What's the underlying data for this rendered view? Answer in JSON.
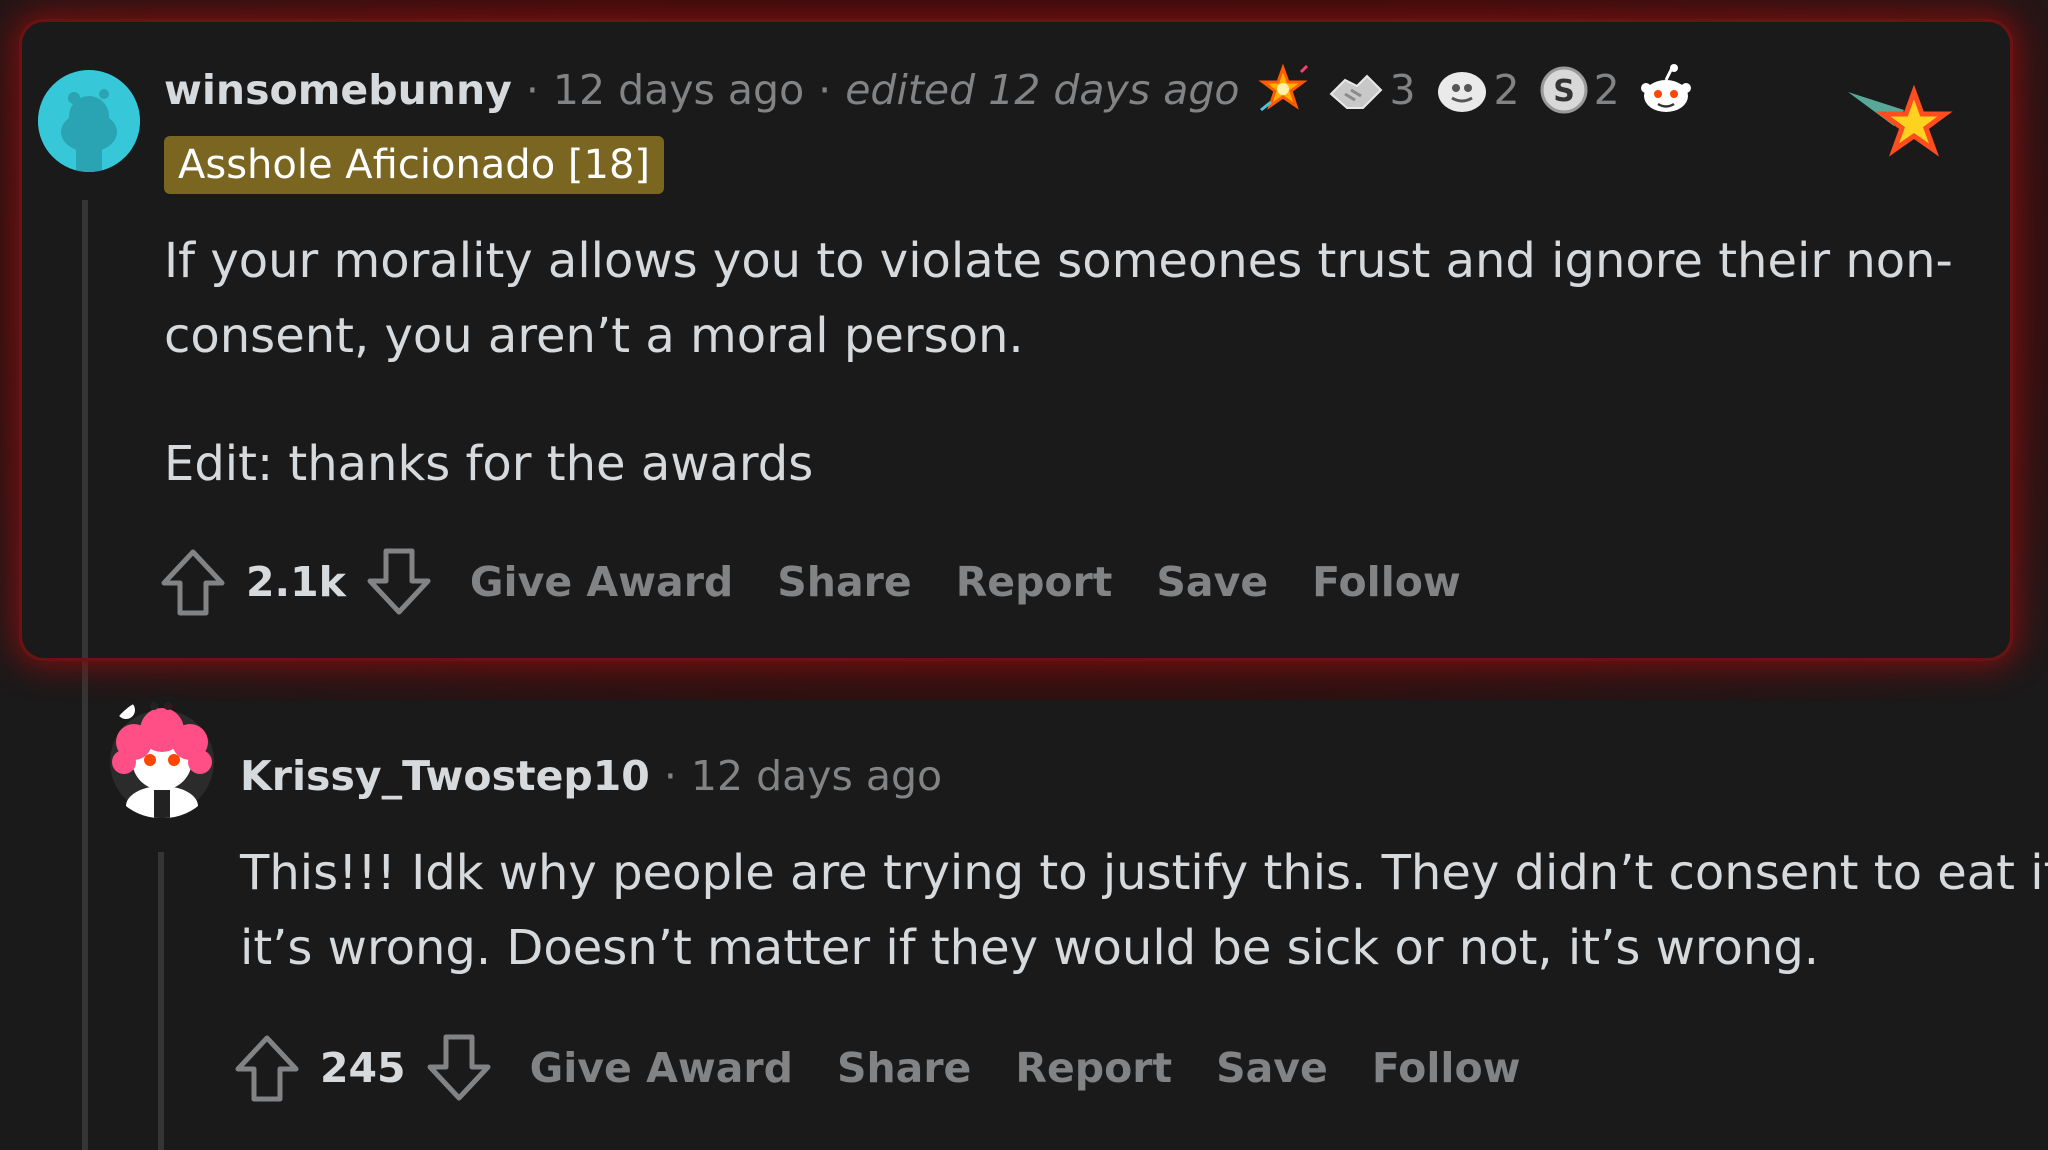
{
  "comment": {
    "username": "winsomebunny",
    "time": "12 days ago",
    "edited": "edited 12 days ago",
    "flair": "Asshole Aficionado [18]",
    "awards": [
      {
        "icon": "burst-star-award-icon",
        "count": ""
      },
      {
        "icon": "handshake-award-icon",
        "count": "3"
      },
      {
        "icon": "face-award-icon",
        "count": "2"
      },
      {
        "icon": "silver-s-award-icon",
        "count": "2"
      },
      {
        "icon": "snoo-award-icon",
        "count": ""
      }
    ],
    "body": {
      "line1": "If your morality allows you to violate someones trust and ignore their non-",
      "line2": "consent, you aren’t a moral person.",
      "line3": "Edit: thanks for the awards"
    },
    "score": "2.1k",
    "actions": {
      "give_award": "Give Award",
      "share": "Share",
      "report": "Report",
      "save": "Save",
      "follow": "Follow"
    }
  },
  "reply": {
    "username": "Krissy_Twostep10",
    "time": "12 days ago",
    "body": {
      "line1": "This!!! Idk why people are trying to justify this. They didn’t consent to eat it,",
      "line2": "it’s wrong. Doesn’t matter if they would be sick or not, it’s wrong."
    },
    "score": "245",
    "actions": {
      "give_award": "Give Award",
      "share": "Share",
      "report": "Report",
      "save": "Save",
      "follow": "Follow"
    }
  },
  "colors": {
    "background": "#1a1a1b",
    "text": "#d7dadc",
    "muted": "#818384",
    "flair_bg": "#7a6521",
    "highlight_glow": "#7a1010"
  }
}
